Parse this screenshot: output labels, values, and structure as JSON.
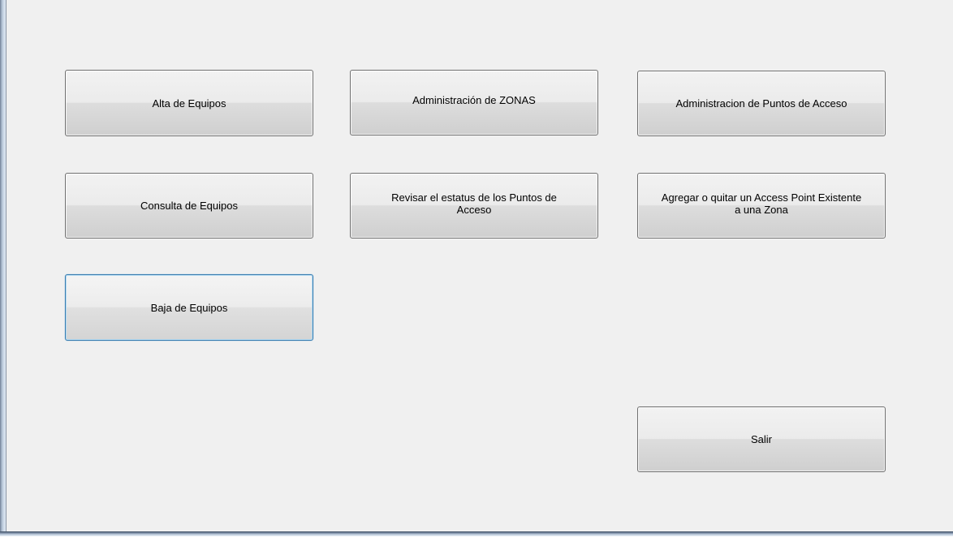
{
  "buttons": {
    "alta_equipos": "Alta de Equipos",
    "admin_zonas": "Administración de ZONAS",
    "admin_puntos_acceso": "Administracion de Puntos de Acceso",
    "consulta_equipos": "Consulta de Equipos",
    "revisar_estatus": "Revisar el estatus de los Puntos de\nAcceso",
    "agregar_quitar_ap": "Agregar o quitar un Access Point Existente\na una Zona",
    "baja_equipos": "Baja de Equipos",
    "salir": "Salir"
  },
  "colors": {
    "client_background": "#f0f0f0",
    "button_border": "#707070",
    "focused_border": "#3c7fb1"
  }
}
